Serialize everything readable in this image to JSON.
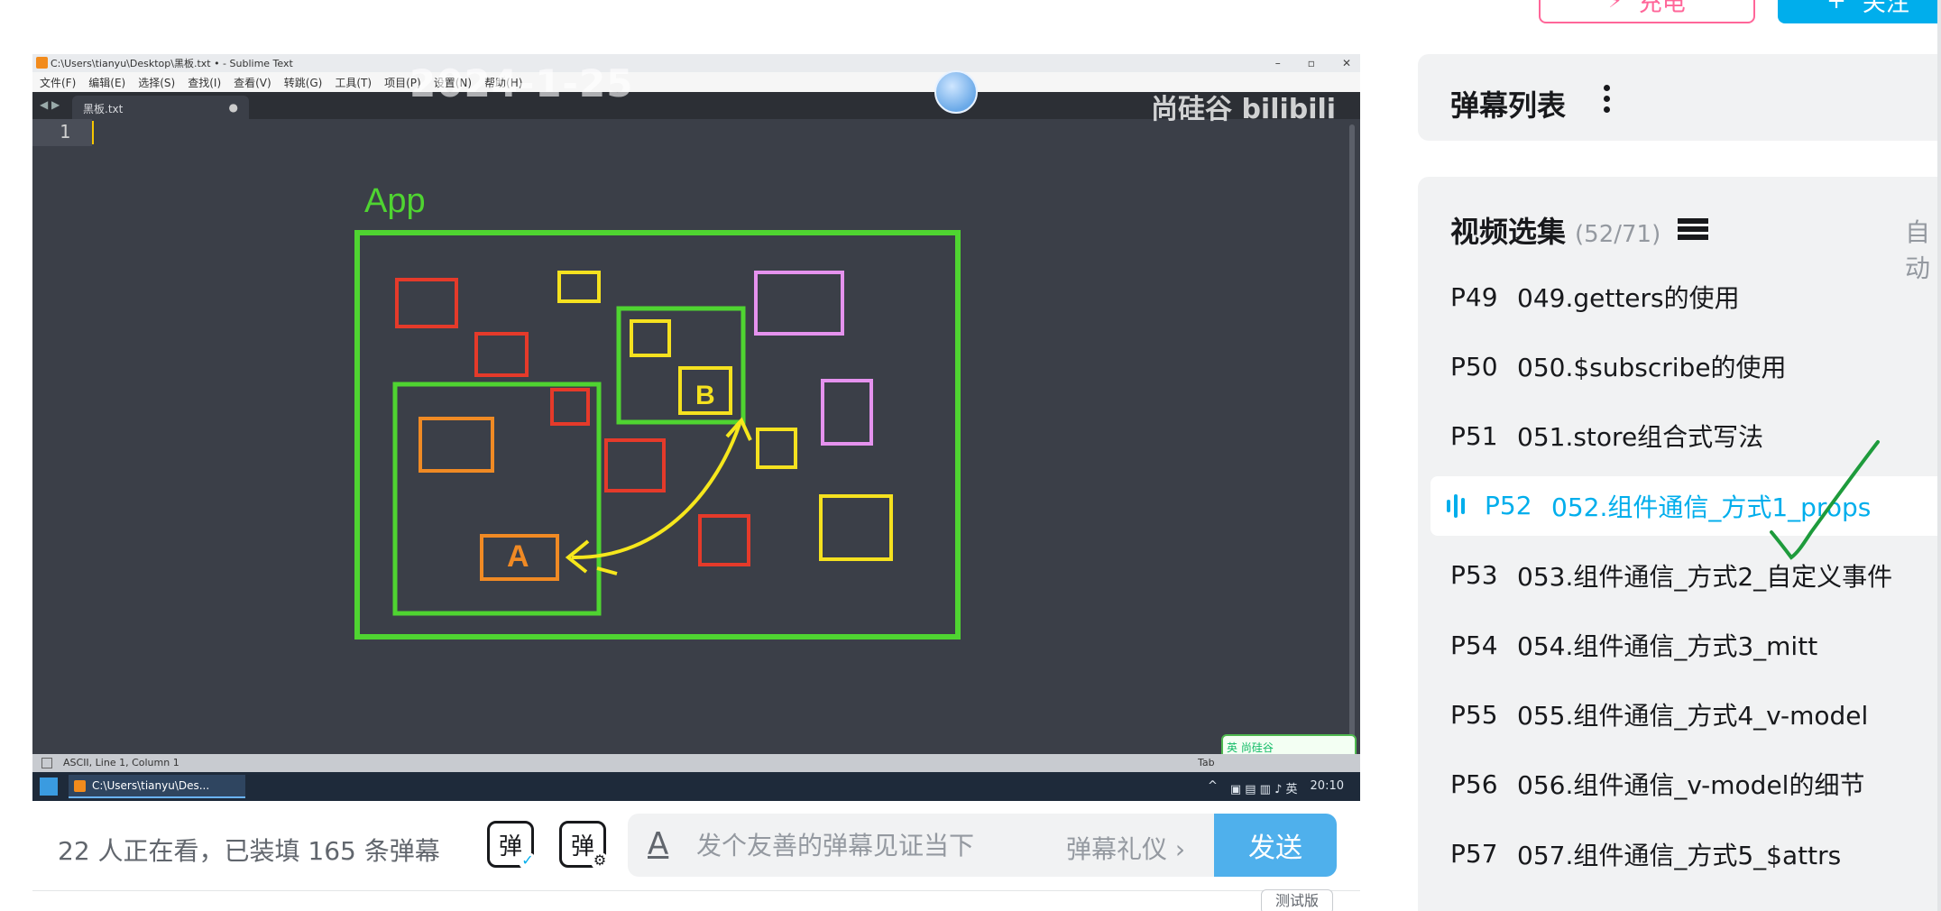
{
  "top_buttons": {
    "charge_label": "充电",
    "follow_label": "关注"
  },
  "player": {
    "window_title": "C:\\Users\\tianyu\\Desktop\\黑板.txt • - Sublime Text",
    "menu_items": [
      "文件(F)",
      "编辑(E)",
      "选择(S)",
      "查找(I)",
      "查看(V)",
      "转跳(G)",
      "工具(T)",
      "项目(P)",
      "设置(N)",
      "帮助(H)"
    ],
    "tab_filename": "黑板.txt",
    "watermark_date": "2024-1-25",
    "watermark_logo": "尚硅谷 bilibili",
    "line_number": "1",
    "status_text": "ASCII, Line 1, Column 1",
    "status_right": "Tab",
    "taskbar_task": "C:\\Users\\tianyu\\Des...",
    "taskbar_time": "20:10",
    "ime_label": "英 尚硅谷",
    "diagram": {
      "labels": {
        "app": "App",
        "a": "A",
        "b": "B"
      },
      "colors": {
        "green": "#4fd431",
        "red": "#e53a2a",
        "yellow": "#f5e11f",
        "orange": "#f08a24",
        "pink": "#e592ee",
        "arrow": "#f6e71c"
      }
    }
  },
  "player_bar": {
    "viewer_text": "22 人正在看，已装填 165 条弹幕",
    "danmaku_toggle_icon": "弹",
    "danmaku_settings_icon": "弹",
    "input_placeholder": "发个友善的弹幕见证当下",
    "etiquette_label": "弹幕礼仪 ›",
    "send_label": "发送"
  },
  "danmaku_list": {
    "title": "弹幕列表"
  },
  "episodes": {
    "title": "视频选集",
    "count": "(52/71)",
    "autoplay_label": "自动",
    "items": [
      {
        "p": "P49",
        "title": "049.getters的使用"
      },
      {
        "p": "P50",
        "title": "050.$subscribe的使用"
      },
      {
        "p": "P51",
        "title": "051.store组合式写法"
      },
      {
        "p": "P52",
        "title": "052.组件通信_方式1_props"
      },
      {
        "p": "P53",
        "title": "053.组件通信_方式2_自定义事件"
      },
      {
        "p": "P54",
        "title": "054.组件通信_方式3_mitt"
      },
      {
        "p": "P55",
        "title": "055.组件通信_方式4_v-model"
      },
      {
        "p": "P56",
        "title": "056.组件通信_v-model的细节"
      },
      {
        "p": "P57",
        "title": "057.组件通信_方式5_$attrs"
      }
    ],
    "active_index": 3
  },
  "test_badge": "测试版"
}
